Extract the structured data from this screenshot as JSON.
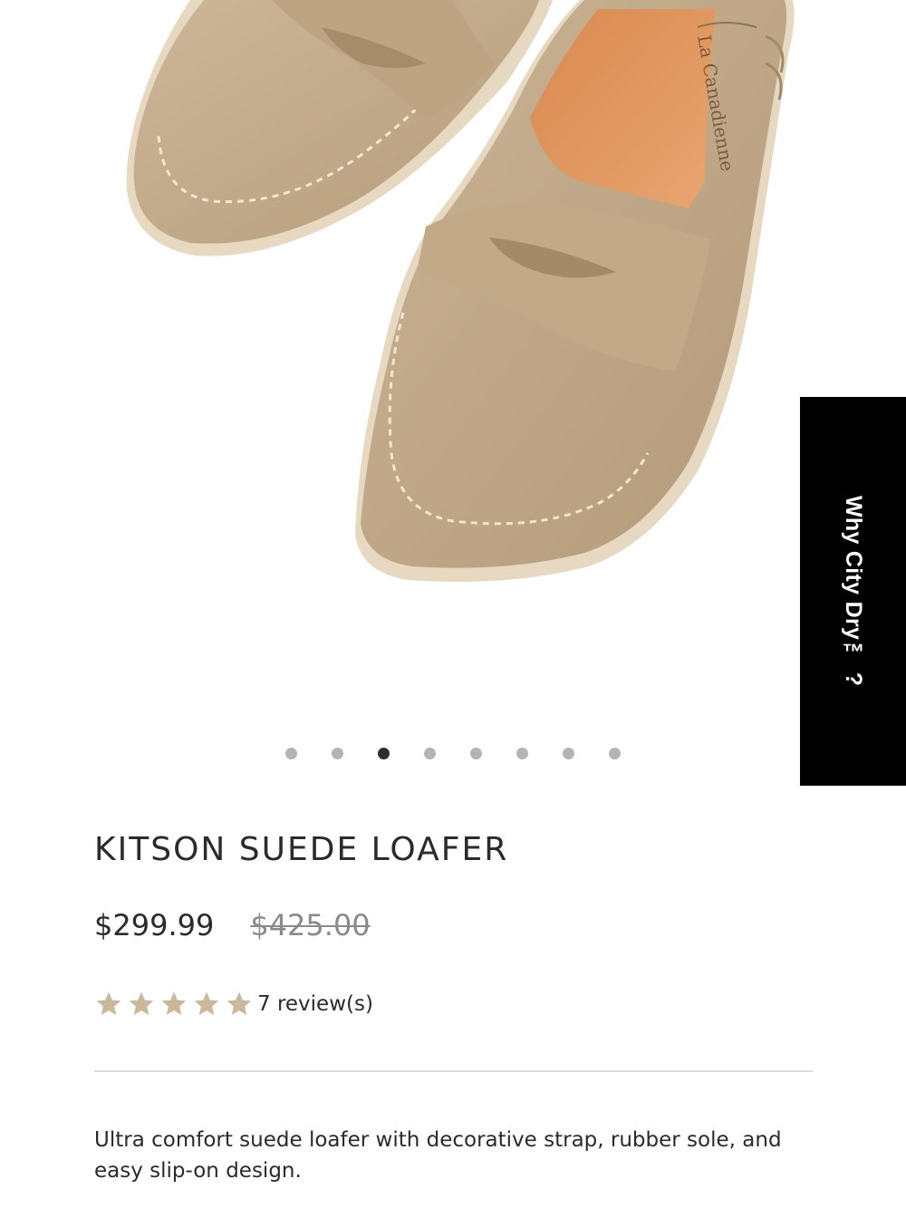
{
  "gallery": {
    "image_alt": "Kitson suede loafer in taupe, top view",
    "brand_imprint": "La Canadienne",
    "slide_count": 8,
    "active_slide": 3
  },
  "side_tab": {
    "label": "Why City Dry™ ?"
  },
  "product": {
    "title": "KITSON SUEDE LOAFER",
    "price": "$299.99",
    "original_price": "$425.00",
    "rating": 5,
    "rating_max": 5,
    "reviews_label": "7 review(s)",
    "description": "Ultra comfort suede loafer with decorative strap, rubber sole, and easy slip-on design."
  },
  "colors": {
    "suede": "#c3ab8c",
    "star": "#c9b99a",
    "tab_bg": "#000000"
  },
  "icons": {
    "star": "star-icon"
  }
}
